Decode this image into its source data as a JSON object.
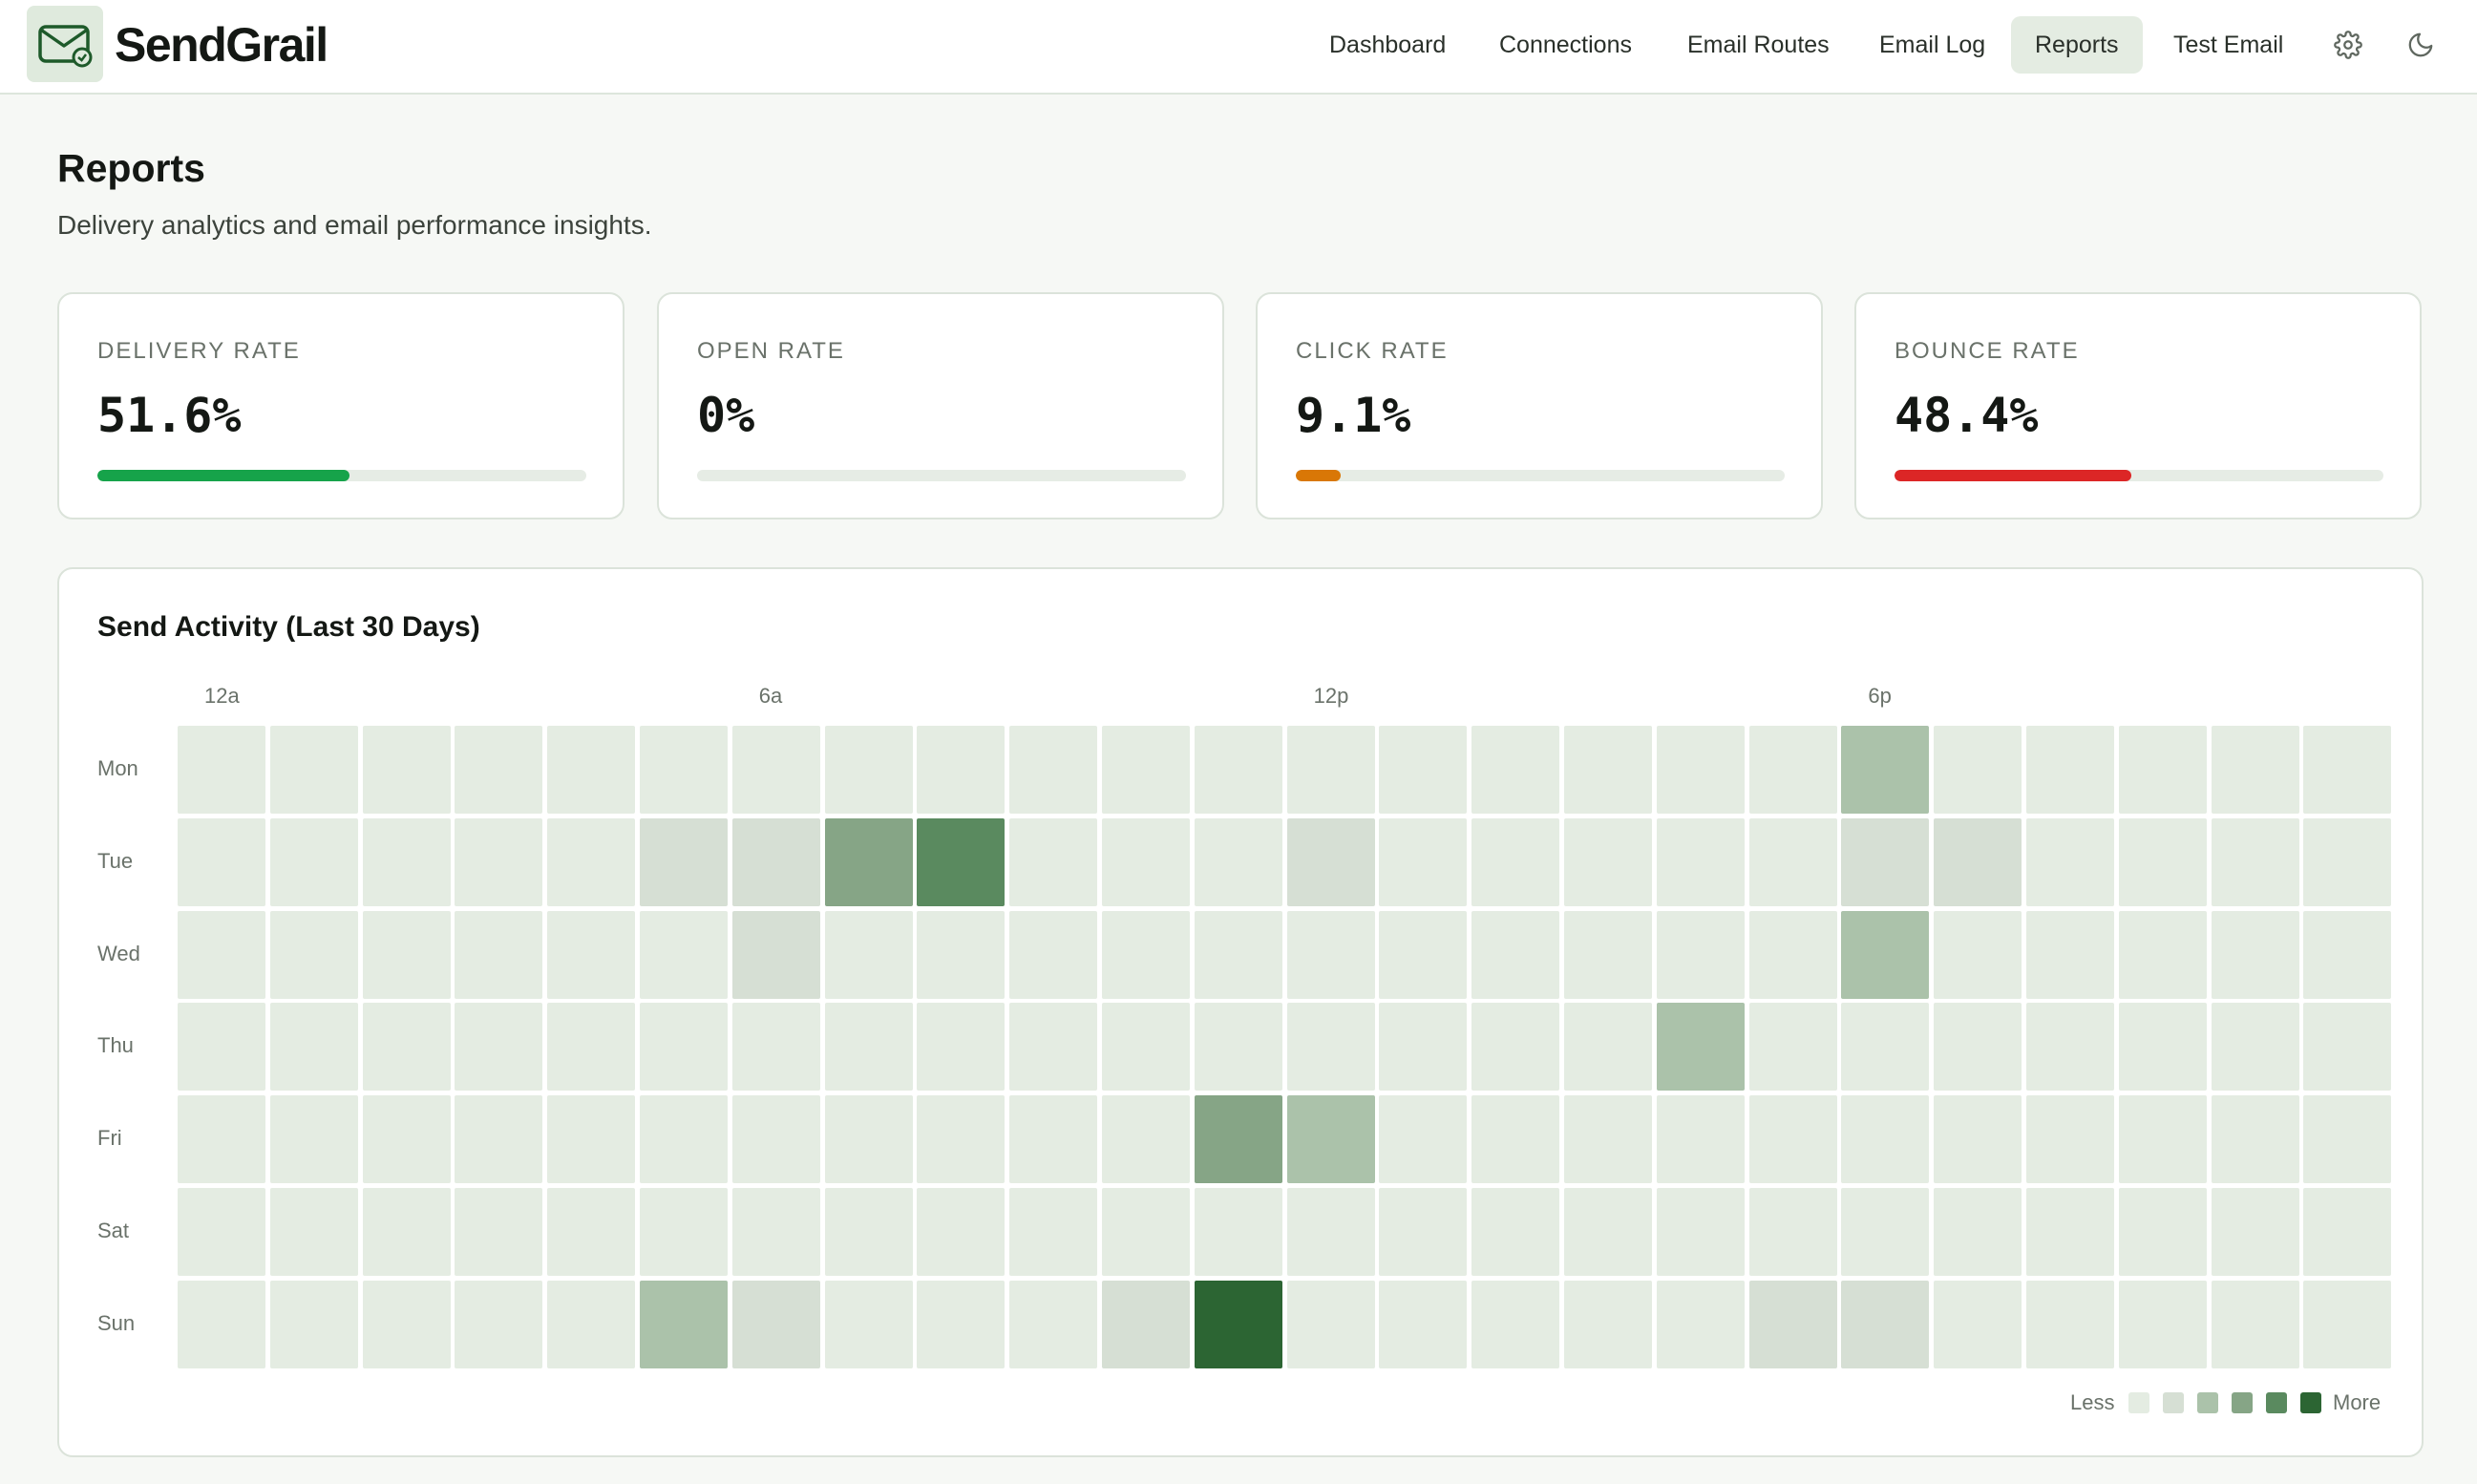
{
  "app": {
    "name_bold": "SendGrail",
    "name_light": ""
  },
  "nav": {
    "items": [
      {
        "label": "Dashboard",
        "active": false
      },
      {
        "label": "Connections",
        "active": false
      },
      {
        "label": "Email Routes",
        "active": false
      },
      {
        "label": "Email Log",
        "active": false
      },
      {
        "label": "Reports",
        "active": true
      },
      {
        "label": "Test Email",
        "active": false
      }
    ],
    "icons": [
      "gear-icon",
      "moon-icon"
    ]
  },
  "page": {
    "title": "Reports",
    "subtitle": "Delivery analytics and email performance insights."
  },
  "stats": [
    {
      "label": "Delivery Rate",
      "value": "51.6%",
      "progress": 0.516,
      "color": "#16a34a"
    },
    {
      "label": "Open Rate",
      "value": "0%",
      "progress": 0.0,
      "color": "#16a34a"
    },
    {
      "label": "Click Rate",
      "value": "9.1%",
      "progress": 0.091,
      "color": "#d97706"
    },
    {
      "label": "Bounce Rate",
      "value": "48.4%",
      "progress": 0.484,
      "color": "#dc2626"
    }
  ],
  "activity": {
    "title": "Send Activity (Last 30 Days)",
    "hour_labels": [
      "12a",
      "6a",
      "12p",
      "6p"
    ],
    "days": [
      "Mon",
      "Tue",
      "Wed",
      "Thu",
      "Fri",
      "Sat",
      "Sun"
    ],
    "levels": [
      [
        0,
        0,
        0,
        0,
        0,
        0,
        0,
        0,
        0,
        0,
        0,
        0,
        0,
        0,
        0,
        0,
        0,
        0,
        2,
        0,
        0,
        0,
        0,
        0
      ],
      [
        0,
        0,
        0,
        0,
        0,
        1,
        1,
        3,
        4,
        0,
        0,
        0,
        1,
        0,
        0,
        0,
        0,
        0,
        1,
        1,
        0,
        0,
        0,
        0
      ],
      [
        0,
        0,
        0,
        0,
        0,
        0,
        1,
        0,
        0,
        0,
        0,
        0,
        0,
        0,
        0,
        0,
        0,
        0,
        2,
        0,
        0,
        0,
        0,
        0
      ],
      [
        0,
        0,
        0,
        0,
        0,
        0,
        0,
        0,
        0,
        0,
        0,
        0,
        0,
        0,
        0,
        0,
        2,
        0,
        0,
        0,
        0,
        0,
        0,
        0
      ],
      [
        0,
        0,
        0,
        0,
        0,
        0,
        0,
        0,
        0,
        0,
        0,
        3,
        2,
        0,
        0,
        0,
        0,
        0,
        0,
        0,
        0,
        0,
        0,
        0
      ],
      [
        0,
        0,
        0,
        0,
        0,
        0,
        0,
        0,
        0,
        0,
        0,
        0,
        0,
        0,
        0,
        0,
        0,
        0,
        0,
        0,
        0,
        0,
        0,
        0
      ],
      [
        0,
        0,
        0,
        0,
        0,
        2,
        1,
        0,
        0,
        0,
        1,
        5,
        0,
        0,
        0,
        0,
        0,
        1,
        1,
        0,
        0,
        0,
        0,
        0
      ]
    ],
    "level_colors": [
      "#e4ece2",
      "#d6dfd4",
      "#abc2aa",
      "#86a586",
      "#5a8a5f",
      "#2c6533"
    ],
    "legend": {
      "less": "Less",
      "more": "More"
    }
  }
}
